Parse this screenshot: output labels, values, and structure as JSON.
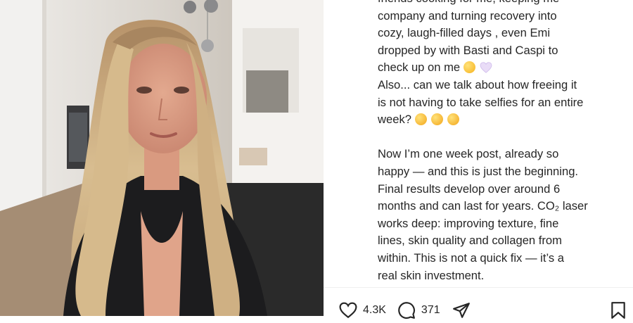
{
  "caption": {
    "lines": [
      "friends cooking for me, keeping me",
      "company and turning recovery into",
      "cozy, laugh-filled days , even Emi",
      "dropped by with Basti and Caspi to",
      "check up on me",
      "Also... can we talk about how freeing it",
      "is not having to take selfies for an entire",
      "week?",
      "Now I’m one week post, already so",
      "happy — and this is just the beginning.",
      "Final results develop over around 6",
      "months and can last for years. CO₂ laser",
      "works deep: improving texture, fine",
      "lines, skin quality and collagen from",
      "within. This is not a quick fix — it’s a",
      "real skin investment."
    ]
  },
  "actions": {
    "likes": "4.3K",
    "comments": "371"
  },
  "icons": {
    "like": "heart-icon",
    "comment": "comment-bubble-icon",
    "share": "paper-plane-icon",
    "save": "bookmark-icon",
    "emoji_1": "crying-face-emoji",
    "emoji_2": "purple-heart-emoji",
    "emoji_3": "laughing-face-emoji"
  }
}
